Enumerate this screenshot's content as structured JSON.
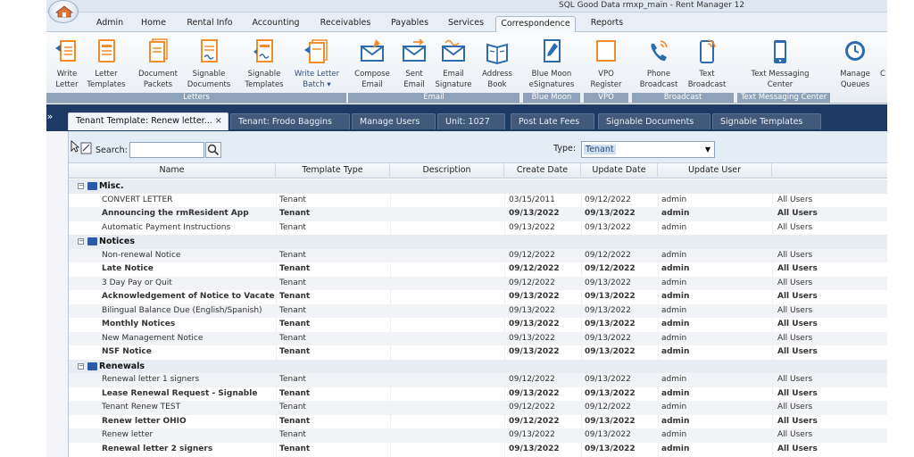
{
  "window": {
    "title": "SQL Good Data rmxp_main - Rent Manager 12"
  },
  "menu": {
    "tabs": [
      {
        "label": "Admin",
        "active": false
      },
      {
        "label": "Home",
        "active": false
      },
      {
        "label": "Rental Info",
        "active": false
      },
      {
        "label": "Accounting",
        "active": false
      },
      {
        "label": "Receivables",
        "active": false
      },
      {
        "label": "Payables",
        "active": false
      },
      {
        "label": "Services",
        "active": false
      },
      {
        "label": "Correspondence",
        "active": true
      },
      {
        "label": "Reports",
        "active": false
      }
    ]
  },
  "ribbon": {
    "write_letter": {
      "l1": "Write",
      "l2": "Letter"
    },
    "letter_templates": {
      "l1": "Letter",
      "l2": "Templates"
    },
    "document_packets": {
      "l1": "Document",
      "l2": "Packets"
    },
    "signable_documents": {
      "l1": "Signable",
      "l2": "Documents"
    },
    "signable_templates": {
      "l1": "Signable",
      "l2": "Templates"
    },
    "write_letter_batch": {
      "l1": "Write Letter",
      "l2": "Batch ▾"
    },
    "compose_email": {
      "l1": "Compose",
      "l2": "Email"
    },
    "sent_email": {
      "l1": "Sent",
      "l2": "Email"
    },
    "email_signature": {
      "l1": "Email",
      "l2": "Signature"
    },
    "address_book": {
      "l1": "Address",
      "l2": "Book"
    },
    "esignatures": {
      "l1": "Blue Moon",
      "l2": "eSignatures"
    },
    "vpo_register": {
      "l1": "VPO",
      "l2": "Register"
    },
    "phone_broadcast": {
      "l1": "Phone",
      "l2": "Broadcast"
    },
    "text_broadcast": {
      "l1": "Text",
      "l2": "Broadcast"
    },
    "text_messaging_center": {
      "l1": "Text Messaging",
      "l2": "Center"
    },
    "manage_queues": {
      "l1": "Manage",
      "l2": "Queues"
    },
    "cut_off": {
      "l1": "C"
    },
    "groups": {
      "letters": "Letters",
      "email": "Email",
      "blue_moon": "Blue Moon",
      "vpo": "VPO",
      "broadcast": "Broadcast",
      "text_messaging": "Text Messaging Center"
    }
  },
  "doc_tabs": {
    "active": {
      "label": "Tenant Template: Renew letter...",
      "close": "×"
    },
    "tenant": "Tenant: Frodo Baggins",
    "manage_users": "Manage Users",
    "unit": "Unit: 1027",
    "late_fees": "Post Late Fees",
    "signable_docs": "Signable Documents",
    "signable_templates": "Signable Templates"
  },
  "toolbar": {
    "search_label": "Search:",
    "search_value": "",
    "type_label": "Type:",
    "type_value": "Tenant"
  },
  "grid": {
    "headers": {
      "name": "Name",
      "type": "Template Type",
      "description": "Description",
      "create": "Create Date",
      "update": "Update Date",
      "user": "Update User"
    },
    "groups": [
      {
        "name": "Misc.",
        "rows": [
          {
            "name": "CONVERT LETTER",
            "type": "Tenant",
            "created": "03/15/2011",
            "updated": "09/12/2022",
            "user": "admin",
            "scope": "All Users",
            "bold": false
          },
          {
            "name": "Announcing the rmResident App",
            "type": "Tenant",
            "created": "09/13/2022",
            "updated": "09/13/2022",
            "user": "admin",
            "scope": "All Users",
            "bold": true
          },
          {
            "name": "Automatic Payment Instructions",
            "type": "Tenant",
            "created": "09/13/2022",
            "updated": "09/13/2022",
            "user": "admin",
            "scope": "All Users",
            "bold": false
          }
        ]
      },
      {
        "name": "Notices",
        "rows": [
          {
            "name": "Non-renewal Notice",
            "type": "Tenant",
            "created": "09/12/2022",
            "updated": "09/12/2022",
            "user": "admin",
            "scope": "All Users",
            "bold": false
          },
          {
            "name": "Late Notice",
            "type": "Tenant",
            "created": "09/12/2022",
            "updated": "09/12/2022",
            "user": "admin",
            "scope": "All Users",
            "bold": true
          },
          {
            "name": "3 Day Pay or Quit",
            "type": "Tenant",
            "created": "09/12/2022",
            "updated": "09/13/2022",
            "user": "admin",
            "scope": "All Users",
            "bold": false
          },
          {
            "name": "Acknowledgement of Notice to Vacate",
            "type": "Tenant",
            "created": "09/13/2022",
            "updated": "09/13/2022",
            "user": "admin",
            "scope": "All Users",
            "bold": true
          },
          {
            "name": "Bilingual Balance Due (English/Spanish)",
            "type": "Tenant",
            "created": "09/13/2022",
            "updated": "09/13/2022",
            "user": "admin",
            "scope": "All Users",
            "bold": false
          },
          {
            "name": "Monthly Notices",
            "type": "Tenant",
            "created": "09/13/2022",
            "updated": "09/13/2022",
            "user": "admin",
            "scope": "All Users",
            "bold": true
          },
          {
            "name": "New Management Notice",
            "type": "Tenant",
            "created": "09/13/2022",
            "updated": "09/13/2022",
            "user": "admin",
            "scope": "All Users",
            "bold": false
          },
          {
            "name": "NSF Notice",
            "type": "Tenant",
            "created": "09/13/2022",
            "updated": "09/13/2022",
            "user": "admin",
            "scope": "All Users",
            "bold": true
          }
        ]
      },
      {
        "name": "Renewals",
        "rows": [
          {
            "name": "Renewal letter 1 signers",
            "type": "Tenant",
            "created": "09/12/2022",
            "updated": "09/13/2022",
            "user": "admin",
            "scope": "All Users",
            "bold": false
          },
          {
            "name": "Lease Renewal Request - Signable",
            "type": "Tenant",
            "created": "09/13/2022",
            "updated": "09/13/2022",
            "user": "admin",
            "scope": "All Users",
            "bold": true
          },
          {
            "name": "Tenant Renew TEST",
            "type": "Tenant",
            "created": "09/12/2022",
            "updated": "09/12/2022",
            "user": "admin",
            "scope": "All Users",
            "bold": false
          },
          {
            "name": "Renew letter OHIO",
            "type": "Tenant",
            "created": "09/12/2022",
            "updated": "09/13/2022",
            "user": "admin",
            "scope": "All Users",
            "bold": true
          },
          {
            "name": "Renew letter",
            "type": "Tenant",
            "created": "09/13/2022",
            "updated": "09/13/2022",
            "user": "admin",
            "scope": "All Users",
            "bold": false
          },
          {
            "name": "Renewal letter 2 signers",
            "type": "Tenant",
            "created": "09/13/2022",
            "updated": "09/13/2022",
            "user": "admin",
            "scope": "All Users",
            "bold": true
          }
        ]
      }
    ]
  },
  "colors": {
    "accent_dark": "#1c3a64",
    "icon_orange": "#f08c2a",
    "icon_blue": "#2d6bb0",
    "folder_blue": "#2d5aa8"
  },
  "icons": {
    "search": "search-icon",
    "folder": "folder-icon",
    "close": "close-icon"
  }
}
